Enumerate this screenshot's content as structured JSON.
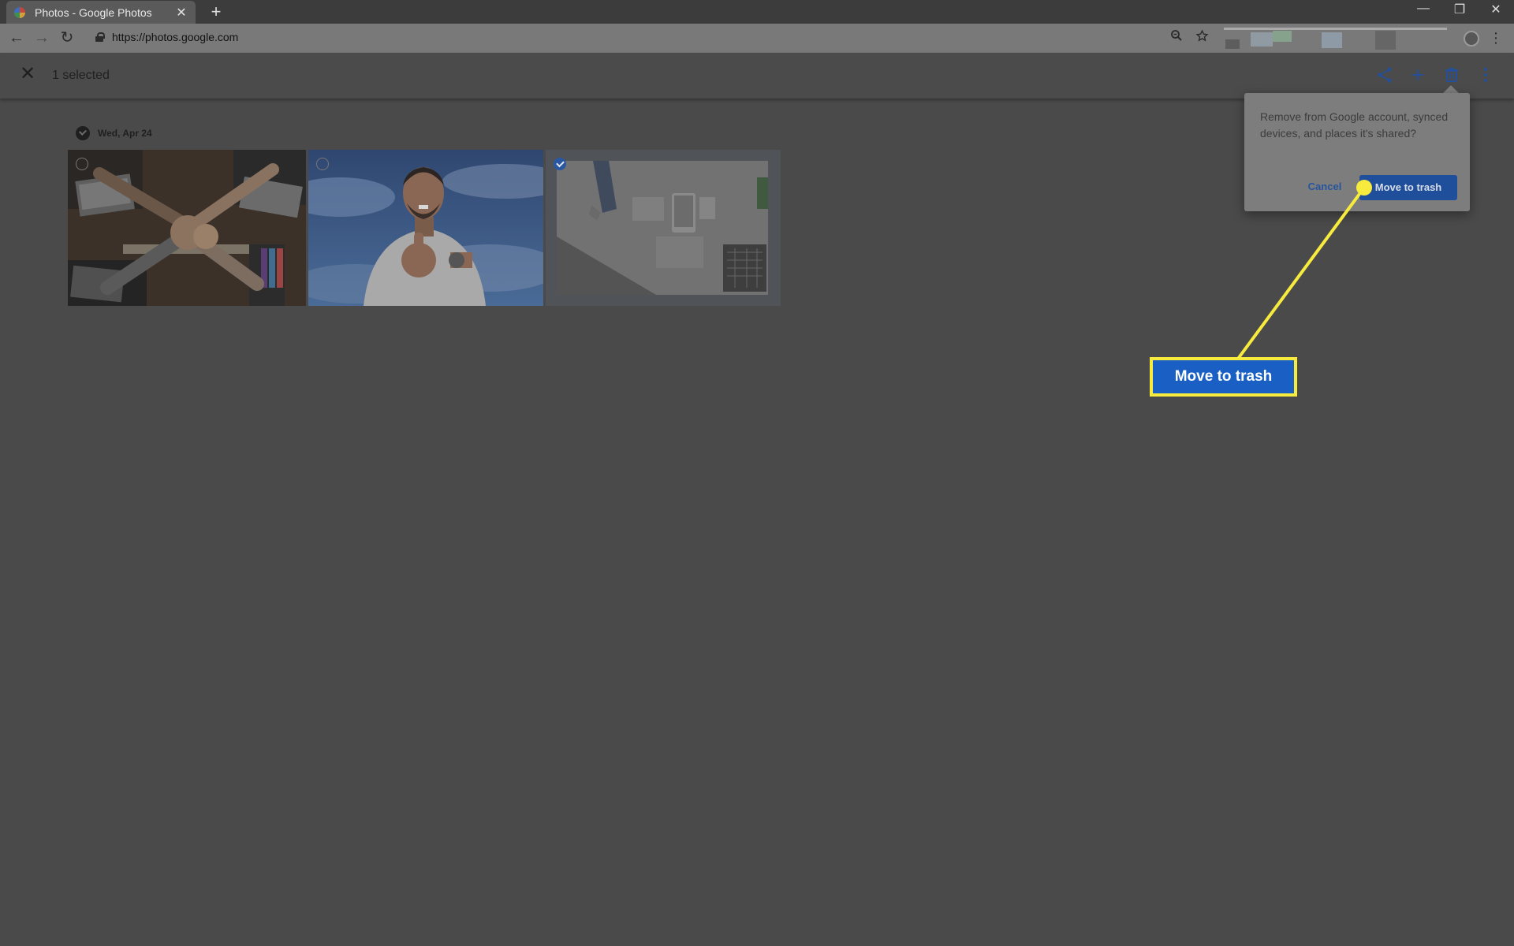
{
  "browser": {
    "tab_title": "Photos - Google Photos",
    "tab_close": "✕",
    "new_tab": "+",
    "url": "https://photos.google.com",
    "window_controls": {
      "minimize": "—",
      "restore": "❐",
      "close": "✕"
    },
    "nav": {
      "back": "←",
      "forward": "→",
      "reload": "↻"
    },
    "menu_dots": "⋮"
  },
  "header": {
    "close": "✕",
    "selected_text": "1 selected",
    "actions": [
      "share-icon",
      "add-icon",
      "trash-icon",
      "more-icon"
    ]
  },
  "photos": {
    "date_label": "Wed, Apr 24",
    "items": [
      {
        "selected": false
      },
      {
        "selected": false
      },
      {
        "selected": true
      }
    ]
  },
  "dialog": {
    "message": "Remove from Google account, synced devices, and places it's shared?",
    "cancel_label": "Cancel",
    "confirm_label": "Move to trash"
  },
  "callout": {
    "label": "Move to trash",
    "colors": {
      "line": "#f7ec3e",
      "box": "#1a5fc4"
    }
  }
}
